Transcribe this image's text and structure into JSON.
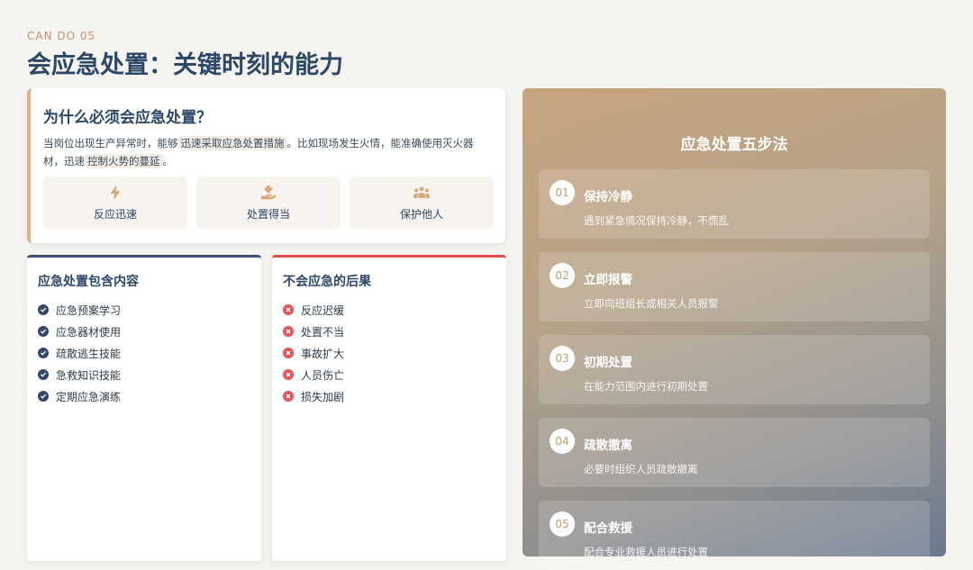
{
  "header": {
    "eyebrow": "CAN DO 05",
    "title": "会应急处置：关键时刻的能力"
  },
  "why": {
    "title": "为什么必须会应急处置？",
    "text_1": "当岗位出现生产异常时，能够",
    "highlight_1": "迅速采取应急处置措施",
    "text_2": "。比如现场发生火情，能准确使用灭火器材，迅速",
    "highlight_2": "控制火势的蔓延",
    "text_3": "。",
    "features": [
      {
        "icon": "lightning-icon",
        "label": "反应迅速"
      },
      {
        "icon": "hand-heart-icon",
        "label": "处置得当"
      },
      {
        "icon": "people-group-icon",
        "label": "保护他人"
      }
    ]
  },
  "contents": {
    "title": "应急处置包含内容",
    "items": [
      "应急预案学习",
      "应急器材使用",
      "疏散逃生技能",
      "急救知识技能",
      "定期应急演练"
    ]
  },
  "consequences": {
    "title": "不会应急的后果",
    "items": [
      "反应迟缓",
      "处置不当",
      "事故扩大",
      "人员伤亡",
      "损失加剧"
    ]
  },
  "steps": {
    "title": "应急处置五步法",
    "items": [
      {
        "num": "01",
        "title": "保持冷静",
        "desc": "遇到紧急情况保持冷静，不慌乱"
      },
      {
        "num": "02",
        "title": "立即报警",
        "desc": "立即向班组长或相关人员报警"
      },
      {
        "num": "03",
        "title": "初期处置",
        "desc": "在能力范围内进行初期处置"
      },
      {
        "num": "04",
        "title": "疏散撤离",
        "desc": "必要时组织人员疏散撤离"
      },
      {
        "num": "05",
        "title": "配合救援",
        "desc": "配合专业救援人员进行处置"
      }
    ]
  },
  "colors": {
    "accent_gold": "#d9b48c",
    "title_navy": "#2c4768",
    "danger_red": "#e24b4b"
  }
}
